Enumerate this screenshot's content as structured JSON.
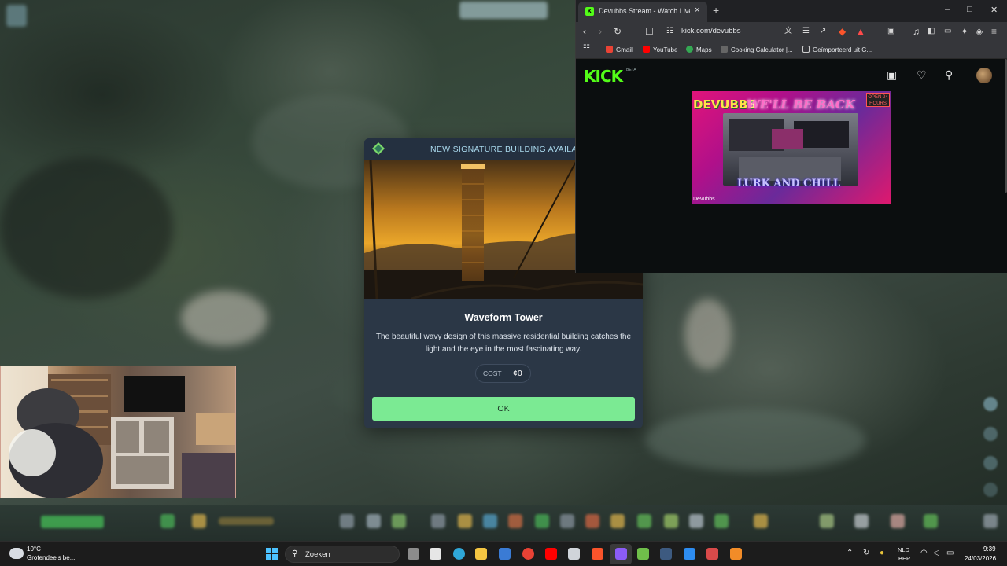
{
  "modal": {
    "header_title": "NEW SIGNATURE BUILDING AVAILABL",
    "title": "Waveform Tower",
    "description": "The beautiful wavy design of this massive residential building catches the light and the eye in the most fascinating way.",
    "cost_label": "COST",
    "cost_value": "¢0",
    "ok_label": "OK"
  },
  "browser": {
    "tab_title": "Devubbs Stream - Watch Live on Kick",
    "tab_close": "×",
    "new_tab": "+",
    "url": "kick.com/devubbs",
    "bookmarks": [
      "Gmail",
      "YouTube",
      "Maps",
      "Cooking Calculator |...",
      "Geïmporteerd uit G..."
    ],
    "page": {
      "logo": "KICK",
      "beta": "BETA",
      "stream": {
        "brand": "DEVUBBS",
        "headline": "WE'LL BE BACK",
        "badge": "OPEN 24 HOURS",
        "footer": "LURK AND CHILL",
        "name": "Devubbs"
      }
    }
  },
  "taskbar": {
    "weather_temp": "10°C",
    "weather_desc": "Grotendeels be...",
    "search_placeholder": "Zoeken",
    "lang_line1": "NLD",
    "lang_line2": "BEP",
    "time": "9:39",
    "date": "24/03/2026"
  },
  "colors": {
    "ok_green": "#7bea93",
    "kick_green": "#53fc18",
    "modal_bg": "#2b3746",
    "header_text": "#a9d8ec"
  }
}
